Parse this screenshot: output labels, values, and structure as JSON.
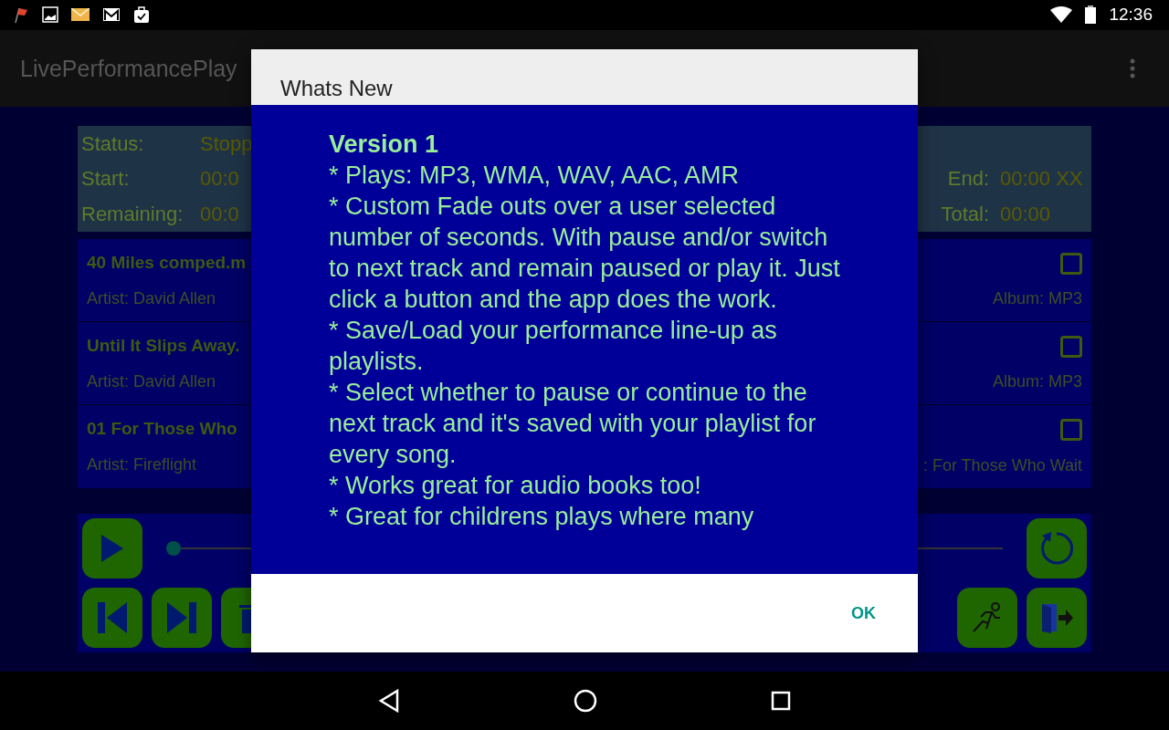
{
  "status_bar": {
    "time": "12:36"
  },
  "app_bar": {
    "title": "LivePerformancePlay"
  },
  "info_panel": {
    "status_label": "Status:",
    "status_value": "Stopp",
    "start_label": "Start:",
    "start_value": "00:0",
    "remaining_label": "Remaining:",
    "remaining_value": "00:0",
    "end_label": "End:",
    "end_value": "00:00 XX",
    "total_label": "Total:",
    "total_value": "00:00"
  },
  "seek": {
    "level": 0
  },
  "tracks": [
    {
      "title": "40 Miles comped.m",
      "artist": "Artist: David Allen",
      "album": "Album: MP3",
      "checked": false
    },
    {
      "title": "Until It Slips Away.",
      "artist": "Artist: David Allen",
      "album": "Album: MP3",
      "checked": false
    },
    {
      "title": "01 For Those Who",
      "artist": "Artist: Fireflight",
      "album": ": For Those Who Wait",
      "checked": false
    }
  ],
  "dialog": {
    "title": "Whats New",
    "heading": "Version 1",
    "items": [
      "* Plays: MP3, WMA, WAV, AAC, AMR",
      "* Custom Fade outs over a user selected number of seconds. With pause and/or switch to next track and remain paused or play it. Just click a button and the app does the work.",
      "* Save/Load your performance line-up as playlists.",
      "* Select whether to pause or continue to the next track and it's saved with your playlist for every song.",
      "* Works great for audio books too!",
      "* Great for childrens plays where many"
    ],
    "button": "OK"
  }
}
